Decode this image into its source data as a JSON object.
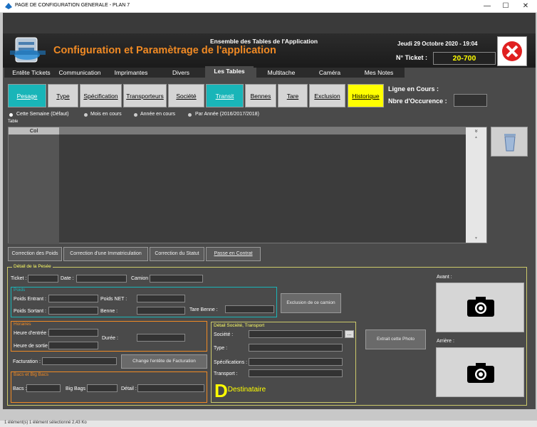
{
  "window": {
    "title": "PAGE DE CONFIGURATION GENERALE - PLAN 7",
    "minimize": "—",
    "maximize": "☐",
    "close": "✕"
  },
  "header": {
    "subtitle": "Ensemble des Tables de l'Application",
    "title": "Configuration et Paramètrage de l'application",
    "date": "Jeudi 29 Octobre 2020 - 19:04",
    "ticket_label": "N° Ticket :",
    "ticket_value": "20-700"
  },
  "tabs": [
    {
      "label": "Entête Tickets"
    },
    {
      "label": "Communication"
    },
    {
      "label": "Imprimantes"
    },
    {
      "label": "Divers"
    },
    {
      "label": "Les Tables"
    },
    {
      "label": "Multitache"
    },
    {
      "label": "Caméra"
    },
    {
      "label": "Mes Notes"
    }
  ],
  "subtabs": [
    {
      "label": "Pesage"
    },
    {
      "label": "Type"
    },
    {
      "label": "Spécification"
    },
    {
      "label": "Transporteurs"
    },
    {
      "label": "Société"
    },
    {
      "label": "Transit"
    },
    {
      "label": "Bennes"
    },
    {
      "label": "Tare"
    },
    {
      "label": "Exclusion"
    },
    {
      "label": "Historique"
    }
  ],
  "info": {
    "ligne_label": "Ligne en Cours :",
    "occurence_label": "Nbre d'Occurence :"
  },
  "filters": {
    "options": [
      "Cette Semaine (Défaut)",
      "Mois en cours",
      "Année en cours",
      "Par Année (2016/2017/2018)"
    ],
    "table_caption": "Table"
  },
  "grid": {
    "col_header": "Col",
    "scroll_top": "»",
    "scroll_up": "▲",
    "scroll_down": "▼"
  },
  "actions": {
    "correction_poids": "Correction des Poids",
    "correction_immat": "Correction d'une Immatriculation",
    "correction_statut": "Correction du Statut",
    "passe_contrat": "Passe en Contrat"
  },
  "detail": {
    "legend": "Détail de la Pesée",
    "ticket": "Ticket :",
    "date": "Date :",
    "camion": "Camion :",
    "poids_legend": "Poids",
    "poids_entrant": "Poids Entrant :",
    "poids_net": "Poids NET :",
    "poids_sortant": "Poids Sortant :",
    "benne": "Benne :",
    "tare_benne": "Tare Benne :",
    "exclusion_btn": "Exclusion de ce camion",
    "horaires_legend": "Horaires",
    "heure_entree": "Heure d'entrée :",
    "heure_sortie": "Heure de sortie :",
    "duree": "Durée :",
    "facturation": "Facturation :",
    "change_entete_btn": "Change l'entête de Facturation",
    "bacs_legend": "Bacs et Big Bacs",
    "bacs": "Bacs :",
    "big_bags": "Big Bags :",
    "detail_field": "Détail :",
    "societe_legend": "Détail Société, Transport",
    "societe": "Société :",
    "type": "Type :",
    "specifications": "Spécifications :",
    "transport": "Transport :",
    "ellipsis": "...",
    "destinataire": "Destinataire",
    "extrait_btn": "Extrait cette Photo",
    "avant": "Avant :",
    "arriere": "Arrière :"
  },
  "status": {
    "text": "1 élément(s)    1 élément sélectionné  2,43 Ko"
  },
  "colors": {
    "teal": "#19b5b8",
    "orange": "#f08a24",
    "yellow": "#ffff00",
    "close_red": "#e02020"
  }
}
